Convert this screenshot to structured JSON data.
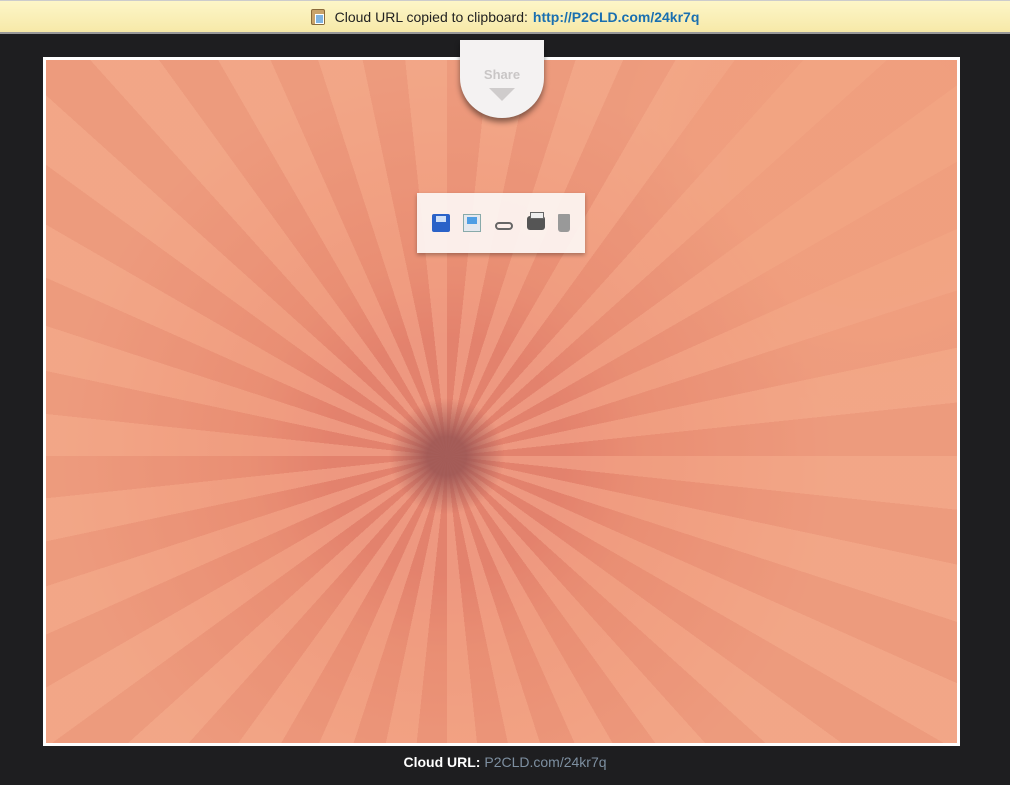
{
  "notification": {
    "icon": "clipboard-icon",
    "message": "Cloud URL copied to clipboard:",
    "url": "http://P2CLD.com/24kr7q"
  },
  "share": {
    "label": "Share",
    "icon": "cloud-icon"
  },
  "toolbar": {
    "items": [
      {
        "icon": "save-icon"
      },
      {
        "icon": "email-icon"
      },
      {
        "icon": "link-icon"
      },
      {
        "icon": "print-icon"
      },
      {
        "icon": "trash-icon"
      }
    ]
  },
  "footer": {
    "label": "Cloud URL",
    "separator": ":",
    "url": "P2CLD.com/24kr7q"
  }
}
